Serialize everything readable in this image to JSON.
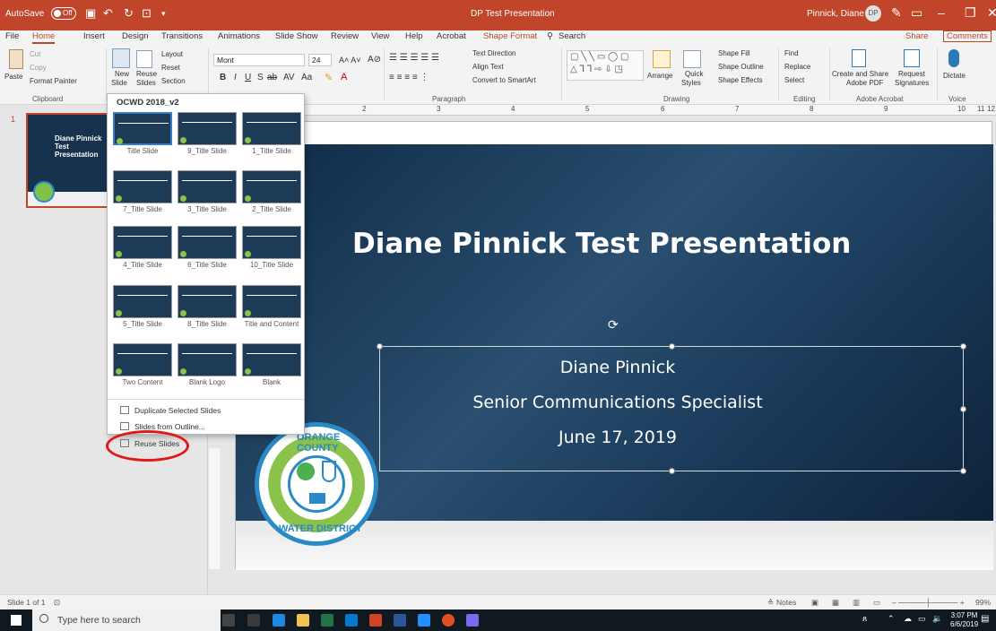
{
  "titlebar": {
    "autosave": "AutoSave",
    "toggle": "Off",
    "doc_title": "DP Test Presentation",
    "user": "Pinnick, Diane",
    "initials": "DP"
  },
  "tabs": [
    "File",
    "Home",
    "Insert",
    "Design",
    "Transitions",
    "Animations",
    "Slide Show",
    "Review",
    "View",
    "Help",
    "Acrobat",
    "Shape Format"
  ],
  "search": "Search",
  "share": "Share",
  "comments": "Comments",
  "ribbon": {
    "paste": "Paste",
    "cut": "Cut",
    "copy": "Copy",
    "format_painter": "Format Painter",
    "clipboard": "Clipboard",
    "new_slide": "New",
    "new_slide2": "Slide",
    "reuse": "Reuse",
    "reuse2": "Slides",
    "layout": "Layout",
    "reset": "Reset",
    "section": "Section",
    "font": "Mont",
    "size": "24",
    "text_direction": "Text Direction",
    "align_text": "Align Text",
    "convert_smartart": "Convert to SmartArt",
    "paragraph": "Paragraph",
    "arrange": "Arrange",
    "quick_styles": "Quick",
    "quick_styles2": "Styles",
    "shape_fill": "Shape Fill",
    "shape_outline": "Shape Outline",
    "shape_effects": "Shape Effects",
    "drawing": "Drawing",
    "find": "Find",
    "replace": "Replace",
    "select": "Select",
    "editing": "Editing",
    "create_share": "Create and Share",
    "adobe_pdf": "Adobe PDF",
    "request": "Request",
    "signatures": "Signatures",
    "adobe_acrobat": "Adobe Acrobat",
    "dictate": "Dictate",
    "voice": "Voice"
  },
  "dropdown": {
    "header": "OCWD 2018_v2",
    "layouts": [
      "Title Slide",
      "9_Title Slide",
      "1_Title Slide",
      "7_Title Slide",
      "3_Title Slide",
      "2_Title Slide",
      "4_Title Slide",
      "6_Title Slide",
      "10_Title Slide",
      "5_Title Slide",
      "8_Title Slide",
      "Title and Content",
      "Two Content",
      "Blank Logo",
      "Blank"
    ],
    "menu": [
      "Duplicate Selected Slides",
      "Slides from Outline...",
      "Reuse Slides"
    ]
  },
  "ruler": [
    "1",
    "2",
    "3",
    "4",
    "5",
    "6",
    "7",
    "8",
    "9",
    "10",
    "11",
    "12"
  ],
  "slide": {
    "thumb_number": "1",
    "title": "Diane Pinnick Test Presentation",
    "name": "Diane Pinnick",
    "role": "Senior Communications Specialist",
    "date": "June 17, 2019",
    "logo_top": "ORANGE COUNTY",
    "logo_bottom": "WATER DISTRICT"
  },
  "status": {
    "slide_of": "Slide 1 of 1",
    "notes": "Notes",
    "zoom": "99%"
  },
  "taskbar": {
    "search_placeholder": "Type here to search",
    "time": "3:07 PM",
    "date": "6/6/2019"
  },
  "colors": {
    "accent": "#c0452a",
    "slide_bg": "#16324f",
    "highlight_circle": "#e01818"
  }
}
